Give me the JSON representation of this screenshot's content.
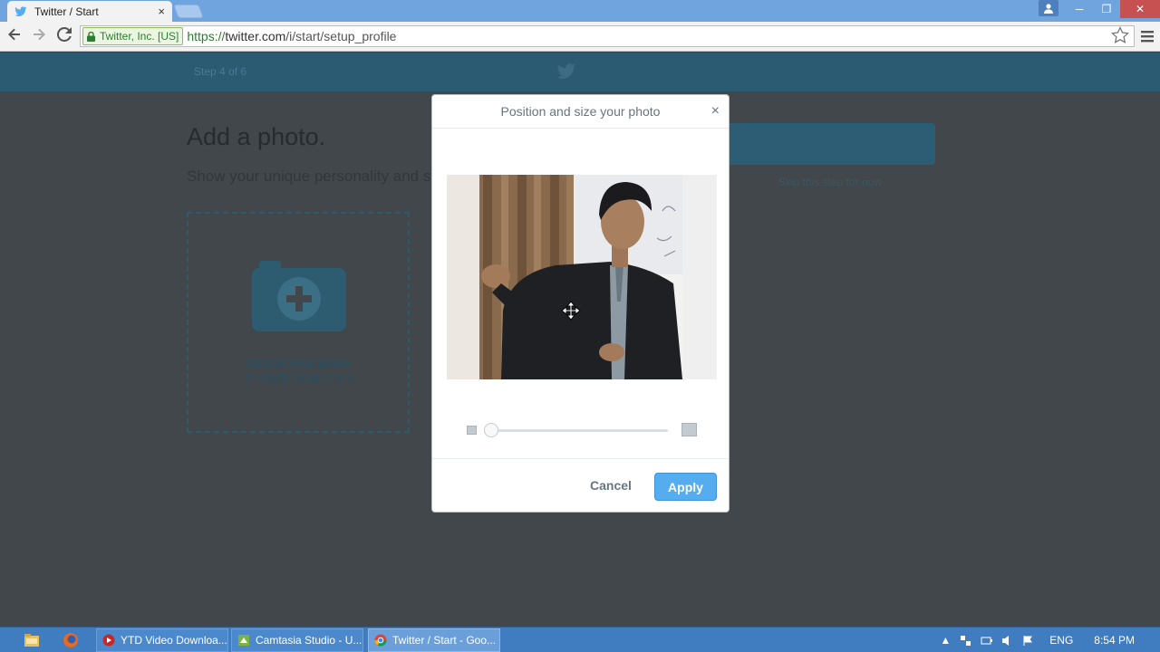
{
  "browser": {
    "tab_title": "Twitter / Start",
    "tab_close": "×",
    "secure_label": "Twitter, Inc. [US]",
    "url_scheme": "https://",
    "url_host": "twitter.com",
    "url_path": "/i/start/setup_profile",
    "window_minimize": "─",
    "window_restore": "❐",
    "window_close": "✕"
  },
  "page": {
    "step_label": "Step 4 of 6",
    "heading": "Add a photo.",
    "subheading": "Show your unique personality and style.",
    "upload_title": "Upload your photo",
    "upload_hint": "or simply drag it here",
    "skip_label": "Skip this step for now"
  },
  "modal": {
    "title": "Position and size your photo",
    "close": "×",
    "zoom_level": 0.0,
    "cancel_label": "Cancel",
    "apply_label": "Apply"
  },
  "taskbar": {
    "tasks": [
      {
        "label": "YTD Video Downloa...",
        "icon": "ytd-icon"
      },
      {
        "label": "Camtasia Studio - U...",
        "icon": "camtasia-icon"
      },
      {
        "label": "Twitter / Start - Goo...",
        "icon": "chrome-icon",
        "active": true
      }
    ],
    "language": "ENG",
    "time": "8:54 PM"
  },
  "colors": {
    "twitter_blue": "#55acee",
    "taskbar": "#3f7cc0",
    "overlay_page": "#41474b"
  }
}
